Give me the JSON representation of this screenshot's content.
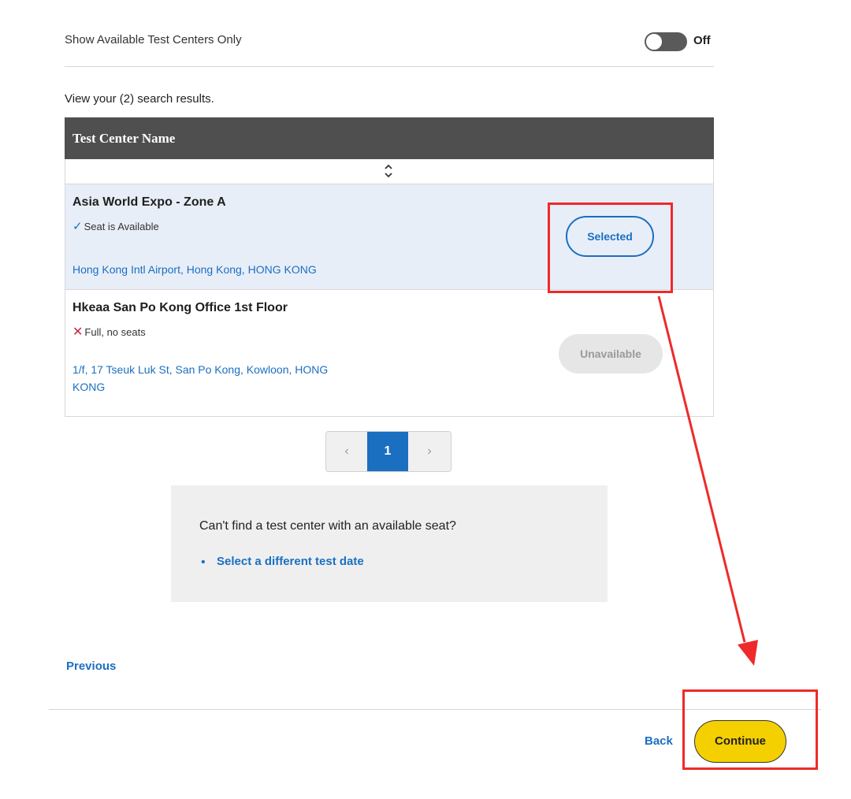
{
  "filter": {
    "toggle_label": "Show Available Test Centers Only",
    "toggle_state": "Off"
  },
  "results": {
    "count_text": "View your (2) search results.",
    "column_header": "Test Center Name",
    "rows": [
      {
        "name": "Asia World Expo - Zone A",
        "status": "Seat is Available",
        "address_line1": "Hong Kong Intl Airport, Hong Kong, HONG KONG",
        "address_line2": "",
        "action": "Selected"
      },
      {
        "name": "Hkeaa San Po Kong Office 1st Floor",
        "status": "Full, no seats",
        "address_line1": "1/f, 17 Tseuk Luk St, San Po Kong, Kowloon, HONG",
        "address_line2": "KONG",
        "action": "Unavailable"
      }
    ]
  },
  "pagination": {
    "prev": "‹",
    "current": "1",
    "next": "›"
  },
  "help": {
    "question": "Can't find a test center with an available seat?",
    "link": "Select a different test date"
  },
  "nav": {
    "previous": "Previous",
    "back": "Back",
    "continue": "Continue"
  },
  "colors": {
    "accent": "#1b6fc1",
    "continue_bg": "#f5d000",
    "annotation": "#ee2a2a"
  }
}
